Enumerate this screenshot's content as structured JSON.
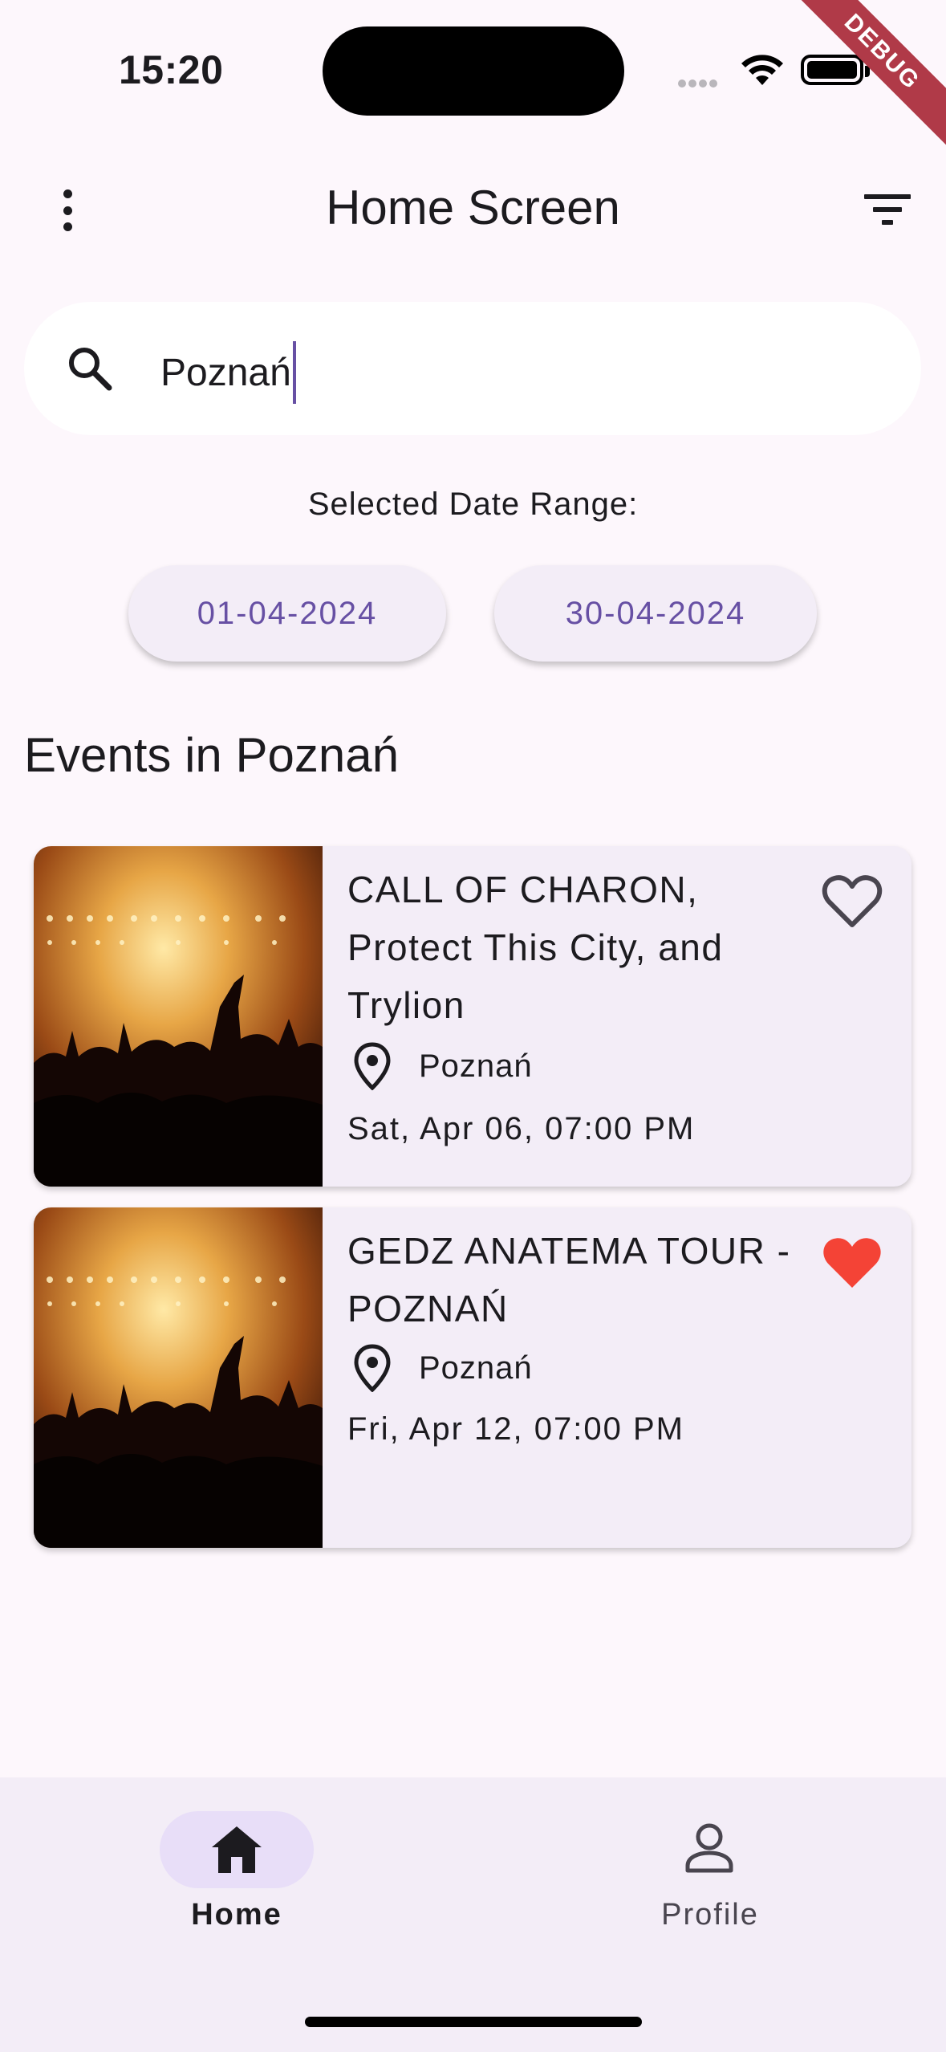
{
  "status_bar": {
    "time": "15:20",
    "icons": [
      "cellular-signal-icon",
      "wifi-icon",
      "battery-icon"
    ],
    "debug_banner": "DEBUG"
  },
  "app_bar": {
    "title": "Home Screen",
    "menu_icon": "more-vert-icon",
    "filter_icon": "filter-list-icon"
  },
  "search": {
    "value": "Poznań",
    "icon": "search-icon"
  },
  "date_range": {
    "label": "Selected Date Range:",
    "start": "01-04-2024",
    "end": "30-04-2024"
  },
  "events_section": {
    "title": "Events in Poznań"
  },
  "events": [
    {
      "title": "CALL OF CHARON, Protect This City, and Trylion",
      "location": "Poznań",
      "datetime": "Sat, Apr 06, 07:00 PM",
      "favorite": false,
      "image": "concert-crowd-image"
    },
    {
      "title": "GEDZ ANATEMA TOUR - POZNAŃ",
      "location": "Poznań",
      "datetime": "Fri, Apr 12, 07:00 PM",
      "favorite": true,
      "image": "concert-crowd-image"
    }
  ],
  "bottom_nav": {
    "items": [
      {
        "label": "Home",
        "icon": "home-icon",
        "selected": true
      },
      {
        "label": "Profile",
        "icon": "person-icon",
        "selected": false
      }
    ]
  },
  "colors": {
    "background": "#fdf7fc",
    "surface": "#f3edf7",
    "primary": "#6750a4",
    "nav_indicator": "#e8def8",
    "favorite": "#f44336"
  }
}
